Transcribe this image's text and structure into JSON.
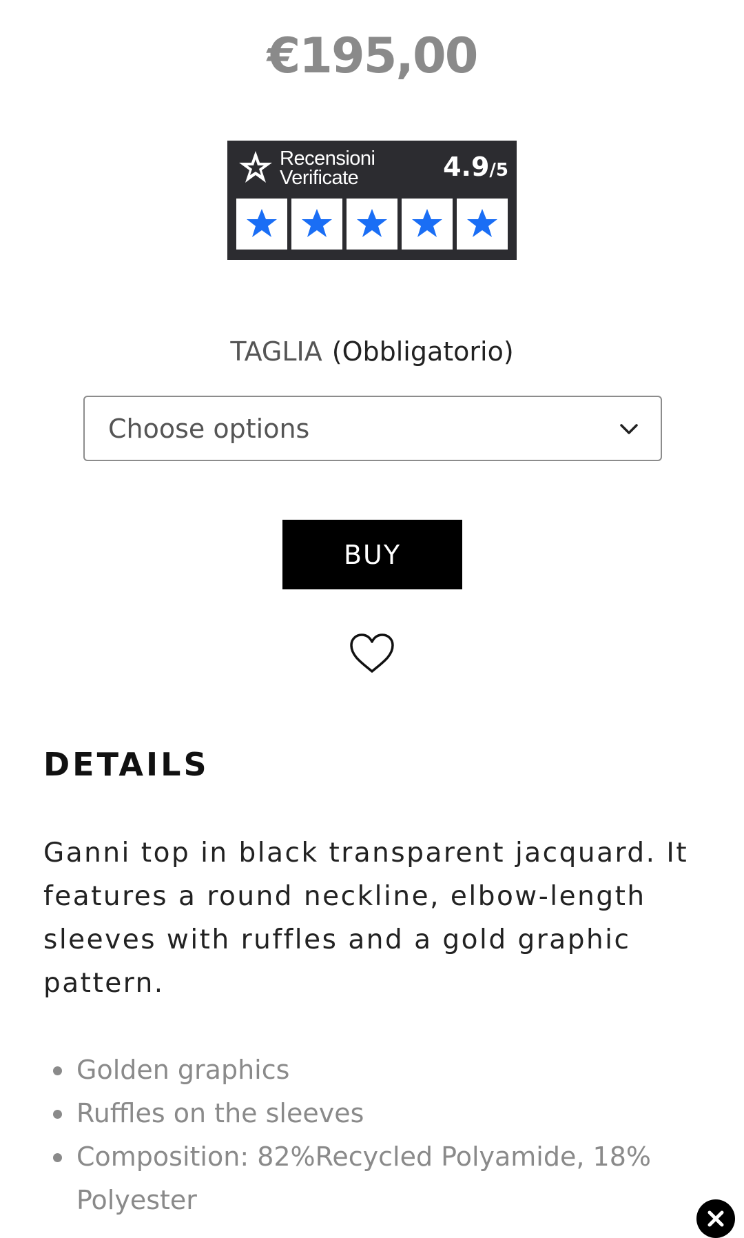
{
  "product": {
    "price": "€195,00"
  },
  "reviews": {
    "brand_line1": "Recensioni",
    "brand_line2": "Verificate",
    "score": "4.9",
    "score_max": "/5",
    "rating": 4.9,
    "star_color": "#1a6ef5",
    "badge_bg": "#2c2c30"
  },
  "size": {
    "label": "TAGLIA",
    "required": "(Obbligatorio)",
    "placeholder": "Choose options"
  },
  "actions": {
    "buy_label": "BUY",
    "wishlist_icon": "heart-outline-icon",
    "close_icon": "close-icon"
  },
  "details": {
    "title": "DETAILS",
    "description": "Ganni top in black transparent jacquard. It features a round neckline, elbow-length sleeves with ruffles and a gold graphic pattern.",
    "features": [
      "Golden graphics",
      "Ruffles on the sleeves",
      "Composition: 82%Recycled Polyamide, 18% Polyester"
    ]
  }
}
